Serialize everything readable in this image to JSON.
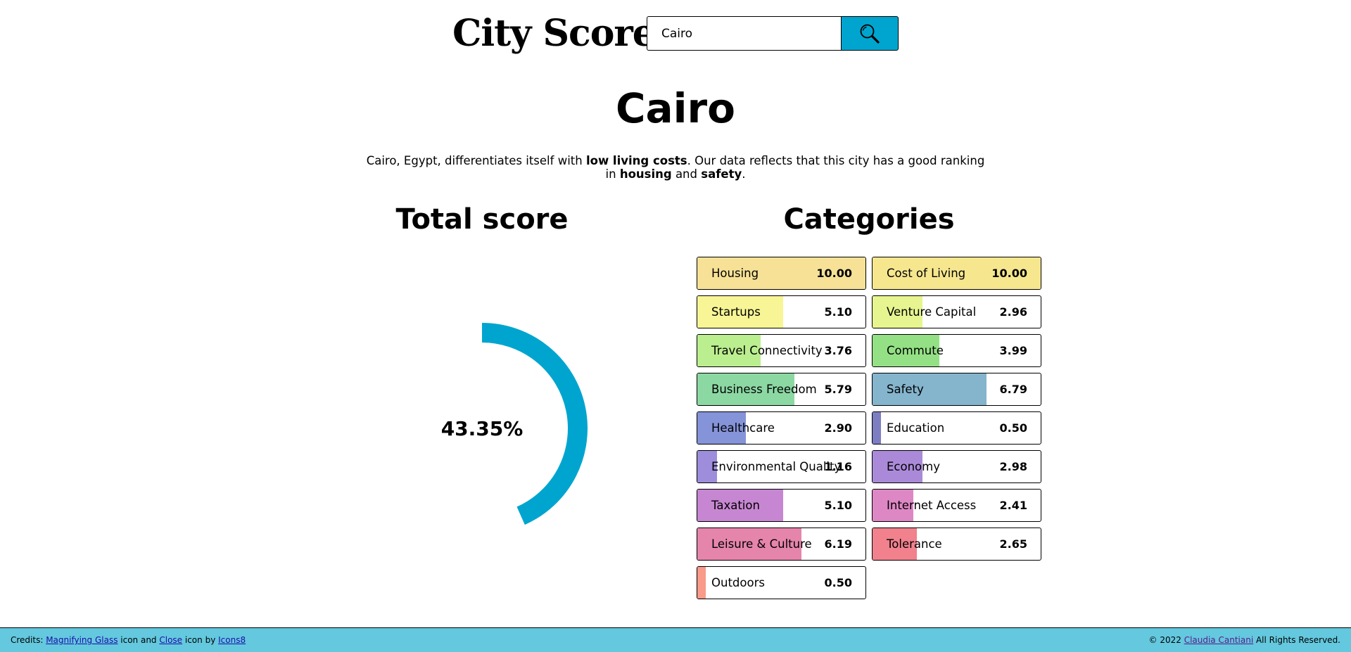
{
  "header": {
    "logo": "City Score",
    "search": {
      "value": "Cairo",
      "placeholder": ""
    },
    "search_icon": "magnifying-glass-icon",
    "accent_color": "#00a5cf"
  },
  "city": {
    "name": "Cairo",
    "summary": {
      "part1": "Cairo, Egypt, differentiates itself with ",
      "bold1": "low living costs",
      "part2": ". Our data reflects that this city has a good ranking in ",
      "bold2": "housing",
      "part3": " and ",
      "bold3": "safety",
      "part4": "."
    }
  },
  "total": {
    "heading": "Total score",
    "label": "43.35%",
    "value": 0.4335,
    "color": "#00a5cf"
  },
  "categories": {
    "heading": "Categories",
    "items": [
      {
        "name": "Housing",
        "score": "10.00",
        "value": 10.0,
        "color": "#f6e196"
      },
      {
        "name": "Cost of Living",
        "score": "10.00",
        "value": 10.0,
        "color": "#f6e78f"
      },
      {
        "name": "Startups",
        "score": "5.10",
        "value": 5.1,
        "color": "#f7f595"
      },
      {
        "name": "Venture Capital",
        "score": "2.96",
        "value": 2.96,
        "color": "#e7f590"
      },
      {
        "name": "Travel Connectivity",
        "score": "3.76",
        "value": 3.76,
        "color": "#bbee8f"
      },
      {
        "name": "Commute",
        "score": "3.99",
        "value": 3.99,
        "color": "#94e185"
      },
      {
        "name": "Business Freedom",
        "score": "5.79",
        "value": 5.79,
        "color": "#8cd8a3"
      },
      {
        "name": "Safety",
        "score": "6.79",
        "value": 6.79,
        "color": "#85b4cd"
      },
      {
        "name": "Healthcare",
        "score": "2.90",
        "value": 2.9,
        "color": "#8593d9"
      },
      {
        "name": "Education",
        "score": "0.50",
        "value": 0.5,
        "color": "#7d7ec2"
      },
      {
        "name": "Environmental Quality",
        "score": "1.16",
        "value": 1.16,
        "color": "#9d8ddb"
      },
      {
        "name": "Economy",
        "score": "2.98",
        "value": 2.98,
        "color": "#aa8ad8"
      },
      {
        "name": "Taxation",
        "score": "5.10",
        "value": 5.1,
        "color": "#c786d1"
      },
      {
        "name": "Internet Access",
        "score": "2.41",
        "value": 2.41,
        "color": "#de87c5"
      },
      {
        "name": "Leisure & Culture",
        "score": "6.19",
        "value": 6.19,
        "color": "#e685ac"
      },
      {
        "name": "Tolerance",
        "score": "2.65",
        "value": 2.65,
        "color": "#f0818d"
      },
      {
        "name": "Outdoors",
        "score": "0.50",
        "value": 0.5,
        "color": "#f99a8a"
      }
    ]
  },
  "footer": {
    "credits_label": "Credits: ",
    "link1": "Magnifying Glass",
    "text1": " icon and ",
    "link2": "Close",
    "text2": " icon by ",
    "link3": "Icons8",
    "copyright_pre": "© 2022 ",
    "author": "Claudia Cantiani",
    "copyright_post": " All Rights Reserved.",
    "background": "#64c8de"
  }
}
